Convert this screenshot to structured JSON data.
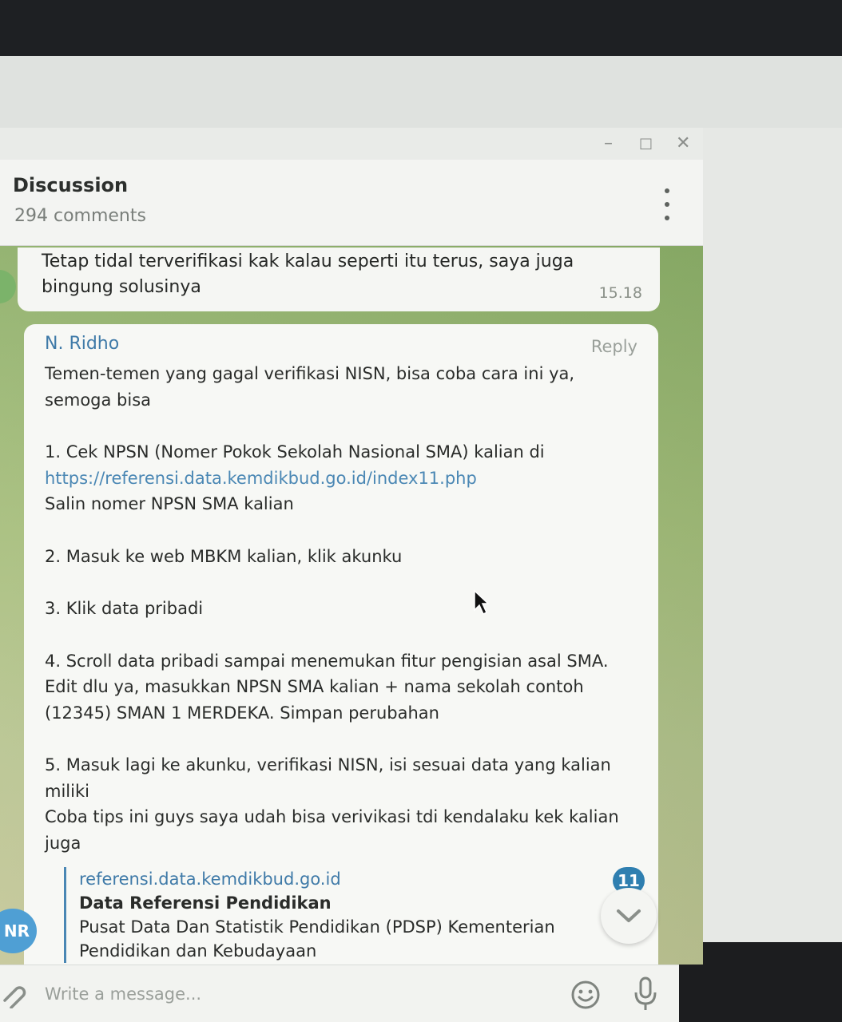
{
  "window": {
    "controls": {
      "minimize": "–",
      "maximize": "□",
      "close": "✕"
    }
  },
  "header": {
    "title": "Discussion",
    "subtitle": "294 comments",
    "menu_icon": "kebab-menu-icon"
  },
  "messages": [
    {
      "text": "Tetap tidal terverifikasi kak kalau seperti itu terus, saya juga bingung solusinya",
      "time": "15.18"
    },
    {
      "sender": "N. Ridho",
      "reply_label": "Reply",
      "lines": {
        "intro": "Temen-temen yang gagal verifikasi NISN, bisa coba cara ini ya, semoga bisa",
        "step1": "1. Cek NPSN (Nomer Pokok Sekolah Nasional SMA) kalian di",
        "step1_link": "https://referensi.data.kemdikbud.go.id/index11.php",
        "step1_b": "Salin nomer NPSN SMA kalian",
        "step2": "2. Masuk ke web MBKM kalian, klik akunku",
        "step3": "3. Klik data pribadi",
        "step4": "4. Scroll data pribadi sampai menemukan fitur pengisian asal SMA. Edit dlu ya, masukkan NPSN SMA kalian + nama sekolah contoh (12345) SMAN 1 MERDEKA. Simpan perubahan",
        "step5": "5. Masuk lagi ke akunku, verifikasi NISN, isi sesuai data yang kalian miliki",
        "outro": "Coba tips ini guys saya udah bisa verivikasi tdi kendalaku kek kalian juga"
      },
      "link_preview": {
        "domain": "referensi.data.kemdikbud.go.id",
        "title": "Data Referensi Pendidikan",
        "description": "Pusat Data Dan Statistik Pendidikan (PDSP) Kementerian Pendidikan dan Kebudayaan"
      }
    }
  ],
  "unread_badge": "11",
  "avatar_initials": "NR",
  "composer": {
    "placeholder": "Write a message..."
  },
  "colors": {
    "accent": "#3f7aa8",
    "badge": "#2f7fb0",
    "avatar": "#4f9fd4",
    "chat_background": "#9fb777"
  }
}
